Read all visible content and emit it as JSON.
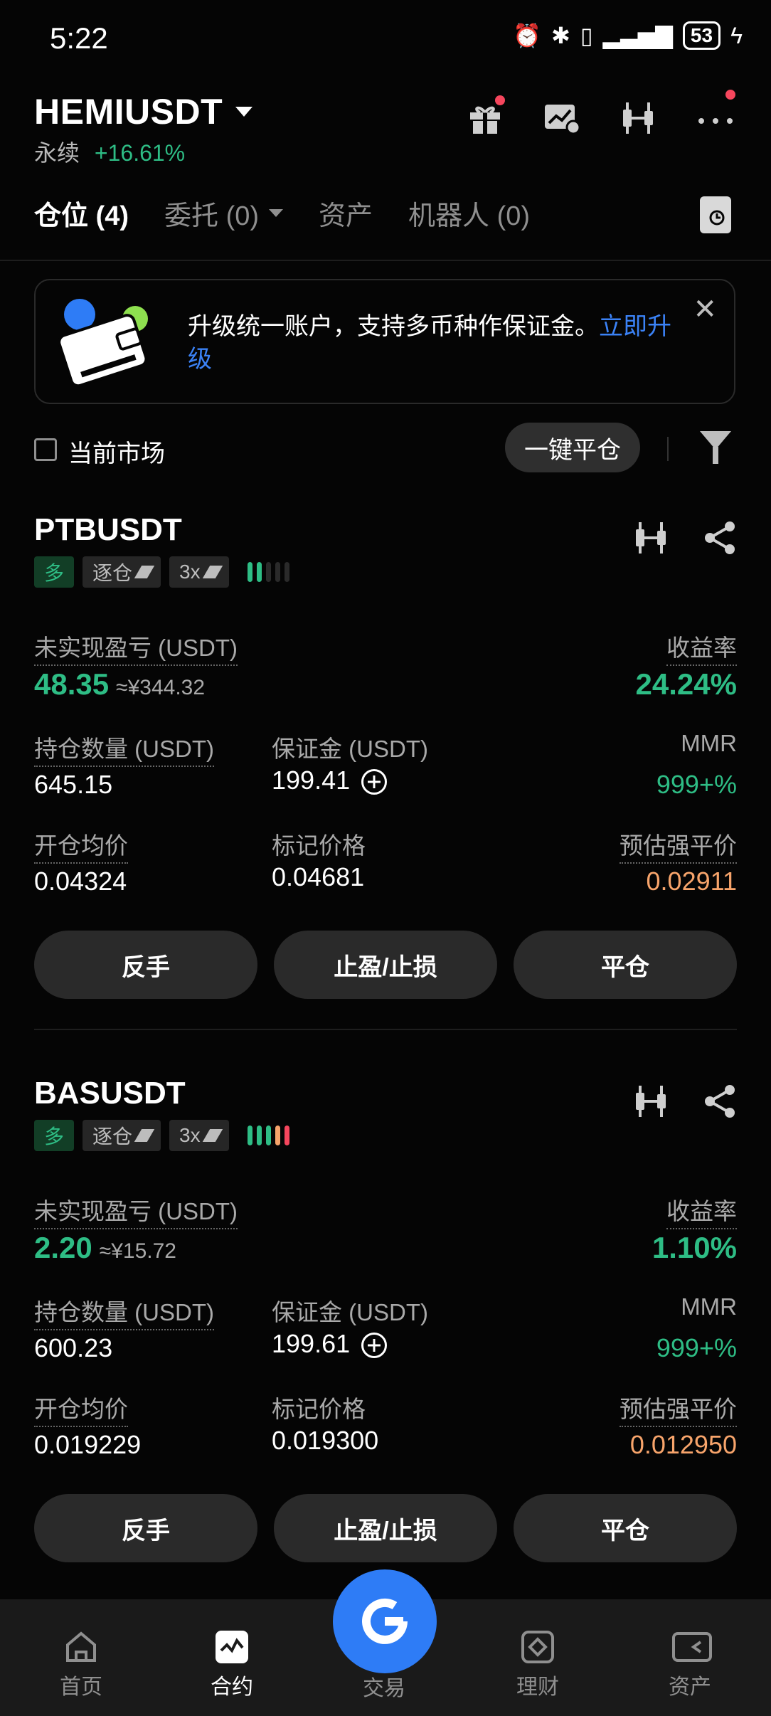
{
  "status_bar": {
    "time": "5:22",
    "battery": "53"
  },
  "header": {
    "symbol": "HEMIUSDT",
    "type": "永续",
    "change": "+16.61%",
    "icons": [
      "gift-icon",
      "chart-check-icon",
      "candlestick-icon",
      "more-icon"
    ]
  },
  "tabs": [
    {
      "label": "仓位 (4)",
      "active": true
    },
    {
      "label": "委托 (0)",
      "dropdown": true
    },
    {
      "label": "资产"
    },
    {
      "label": "机器人 (0)"
    }
  ],
  "banner": {
    "text": "升级统一账户，支持多币种作保证金。",
    "link": "立即升级"
  },
  "filters": {
    "checkbox_label": "当前市场",
    "close_all": "一键平仓"
  },
  "positions": [
    {
      "pair": "PTBUSDT",
      "side": "多",
      "margin_mode": "逐仓",
      "leverage": "3x",
      "risk_level": 2,
      "labels": {
        "pnl": "未实现盈亏 (USDT)",
        "roe": "收益率",
        "size": "持仓数量 (USDT)",
        "margin": "保证金 (USDT)",
        "mmr": "MMR",
        "entry": "开仓均价",
        "mark": "标记价格",
        "liq": "预估强平价"
      },
      "pnl": "48.35",
      "pnl_cny": "≈¥344.32",
      "roe": "24.24%",
      "size": "645.15",
      "margin": "199.41",
      "mmr": "999+%",
      "entry": "0.04324",
      "mark": "0.04681",
      "liq": "0.02911",
      "buttons": [
        "反手",
        "止盈/止损",
        "平仓"
      ]
    },
    {
      "pair": "BASUSDT",
      "side": "多",
      "margin_mode": "逐仓",
      "leverage": "3x",
      "risk_level": 5,
      "labels": {
        "pnl": "未实现盈亏 (USDT)",
        "roe": "收益率",
        "size": "持仓数量 (USDT)",
        "margin": "保证金 (USDT)",
        "mmr": "MMR",
        "entry": "开仓均价",
        "mark": "标记价格",
        "liq": "预估强平价"
      },
      "pnl": "2.20",
      "pnl_cny": "≈¥15.72",
      "roe": "1.10%",
      "size": "600.23",
      "margin": "199.61",
      "mmr": "999+%",
      "entry": "0.019229",
      "mark": "0.019300",
      "liq": "0.012950",
      "buttons": [
        "反手",
        "止盈/止损",
        "平仓"
      ]
    }
  ],
  "bottom_nav": [
    {
      "label": "首页",
      "icon": "home-icon"
    },
    {
      "label": "合约",
      "icon": "futures-icon",
      "active": true
    },
    {
      "label": "交易",
      "icon": "trade-icon"
    },
    {
      "label": "理财",
      "icon": "earn-icon"
    },
    {
      "label": "资产",
      "icon": "wallet-icon"
    }
  ],
  "colors": {
    "up": "#2ebd85",
    "liq": "#f7a46b",
    "accent": "#2e7cf6",
    "alert": "#f6465d"
  }
}
